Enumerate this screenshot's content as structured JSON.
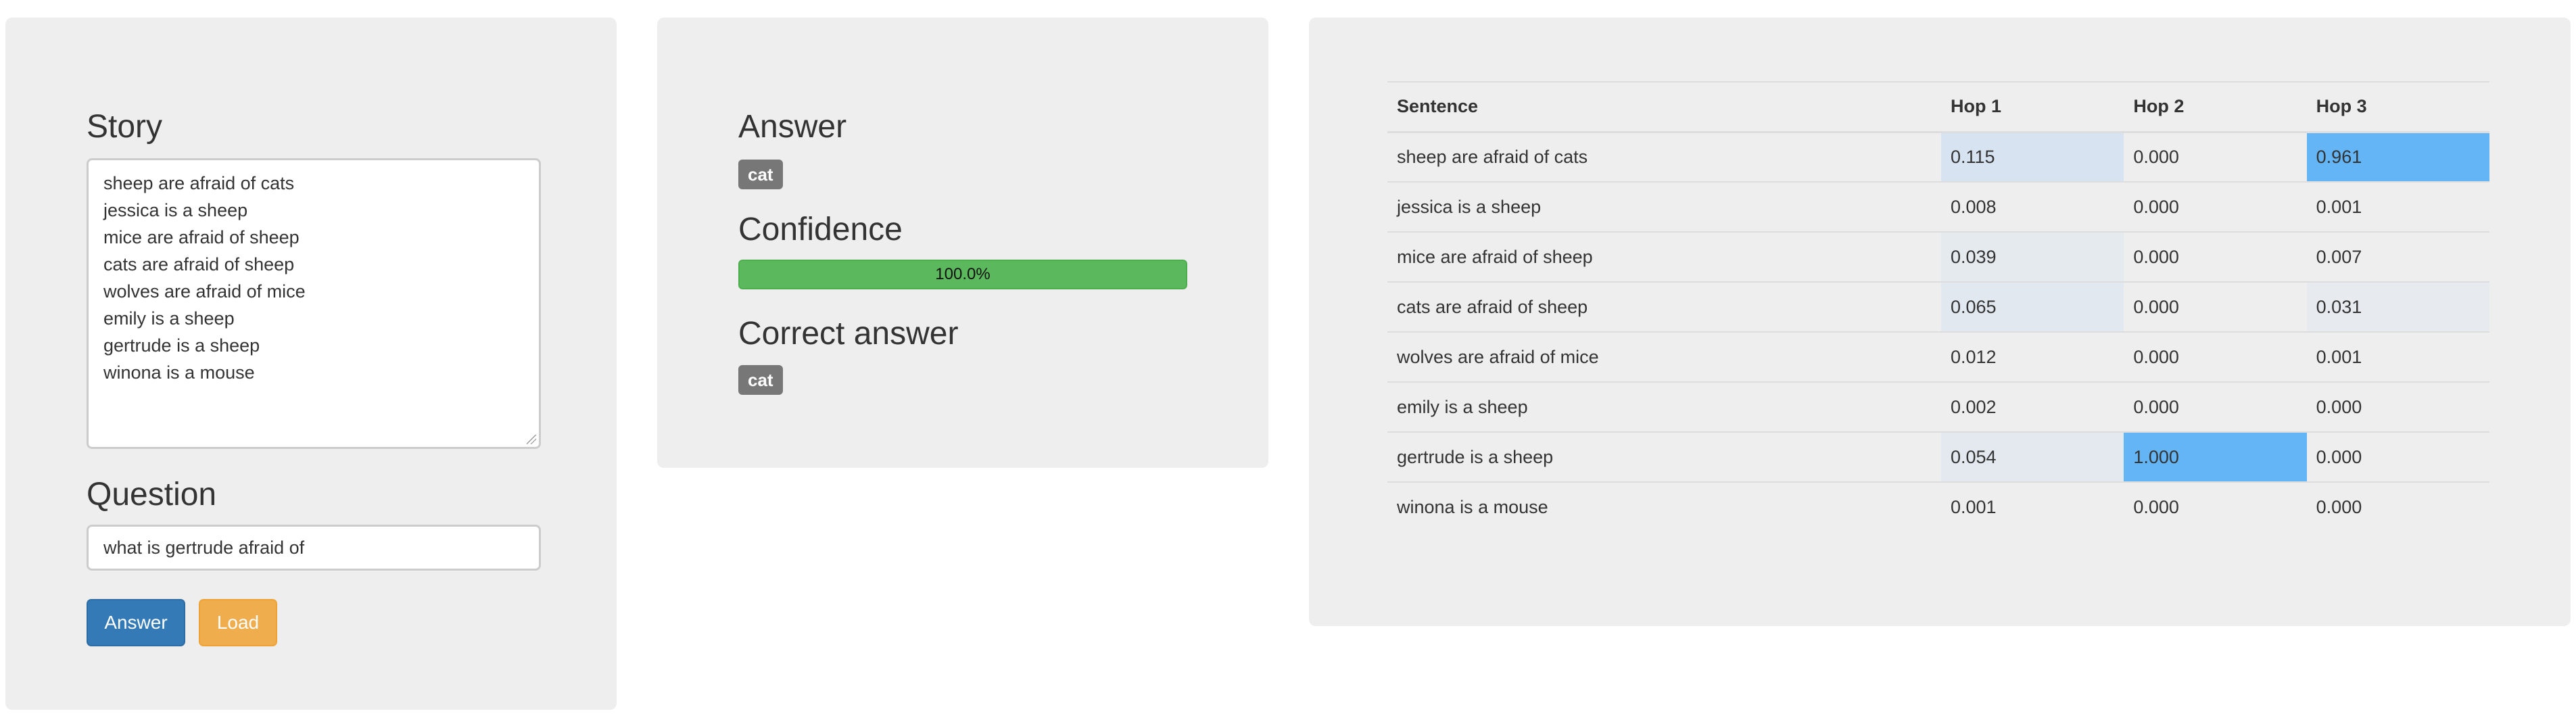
{
  "story_panel": {
    "story_heading": "Story",
    "story_lines": [
      "sheep are afraid of cats",
      "jessica is a sheep",
      "mice are afraid of sheep",
      "cats are afraid of sheep",
      "wolves are afraid of mice",
      "emily is a sheep",
      "gertrude is a sheep",
      "winona is a mouse"
    ],
    "question_heading": "Question",
    "question_value": "what is gertrude afraid of",
    "answer_button": "Answer",
    "load_button": "Load"
  },
  "answer_panel": {
    "answer_heading": "Answer",
    "answer_value": "cat",
    "confidence_heading": "Confidence",
    "confidence_text": "100.0%",
    "confidence_fraction": 1.0,
    "correct_heading": "Correct answer",
    "correct_value": "cat"
  },
  "attention_table": {
    "headers": [
      "Sentence",
      "Hop 1",
      "Hop 2",
      "Hop 3"
    ],
    "rows": [
      {
        "sentence": "sheep are afraid of cats",
        "hop1": "0.115",
        "hop2": "0.000",
        "hop3": "0.961"
      },
      {
        "sentence": "jessica is a sheep",
        "hop1": "0.008",
        "hop2": "0.000",
        "hop3": "0.001"
      },
      {
        "sentence": "mice are afraid of sheep",
        "hop1": "0.039",
        "hop2": "0.000",
        "hop3": "0.007"
      },
      {
        "sentence": "cats are afraid of sheep",
        "hop1": "0.065",
        "hop2": "0.000",
        "hop3": "0.031"
      },
      {
        "sentence": "wolves are afraid of mice",
        "hop1": "0.012",
        "hop2": "0.000",
        "hop3": "0.001"
      },
      {
        "sentence": "emily is a sheep",
        "hop1": "0.002",
        "hop2": "0.000",
        "hop3": "0.000"
      },
      {
        "sentence": "gertrude is a sheep",
        "hop1": "0.054",
        "hop2": "1.000",
        "hop3": "0.000"
      },
      {
        "sentence": "winona is a mouse",
        "hop1": "0.001",
        "hop2": "0.000",
        "hop3": "0.000"
      }
    ],
    "highlight_color": "#64b5f6"
  },
  "colors": {
    "panel_bg": "#eeeeee",
    "primary_button": "#337ab7",
    "warning_button": "#f0ad4e",
    "progress_success": "#5cb85c",
    "badge_bg": "#777777"
  }
}
